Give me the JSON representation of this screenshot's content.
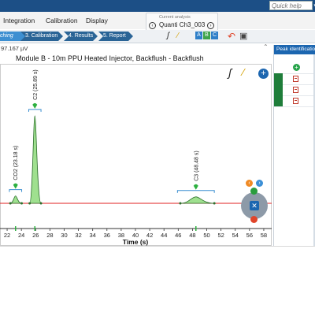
{
  "quick_help": {
    "placeholder": "Quick help"
  },
  "menu": {
    "items": [
      "Integration",
      "Calibration",
      "Display"
    ]
  },
  "current_analysis": {
    "label": "Current analysis",
    "value": "Quanti Ch3_003"
  },
  "workflow": {
    "steps": [
      "ching",
      "3. Calibration",
      "4. Results",
      "5. Report"
    ]
  },
  "toolbar": {
    "abc_labels": [
      "A",
      "B",
      "C"
    ]
  },
  "signal_readout": "97.167 µV",
  "chart": {
    "title": "Module B - 10m PPU Heated Injector, Backflush - Backflush",
    "xlabel": "Time (s)"
  },
  "right_panel": {
    "header": "Peak identification"
  },
  "chart_data": {
    "type": "line",
    "title": "Module B - 10m PPU Heated Injector, Backflush - Backflush",
    "xlabel": "Time (s)",
    "ylabel": "",
    "xlim": [
      21,
      59
    ],
    "x_ticks": [
      22,
      24,
      26,
      28,
      30,
      32,
      34,
      36,
      38,
      40,
      42,
      44,
      46,
      48,
      50,
      52,
      54,
      56,
      58
    ],
    "baseline": 0,
    "peaks": [
      {
        "name": "CO2",
        "time_label": "CO2 (23.18 s)",
        "rt": 23.18,
        "height": 0.08
      },
      {
        "name": "C2",
        "time_label": "C2 (25.89 s)",
        "rt": 25.89,
        "height": 0.95
      },
      {
        "name": "C3",
        "time_label": "C3 (48.48 s)",
        "rt": 48.48,
        "height": 0.07
      }
    ],
    "colors": {
      "baseline": "#e02020",
      "trace": "#2c6e2c",
      "fill": "#9fe08f",
      "marker": "#2db040"
    }
  }
}
